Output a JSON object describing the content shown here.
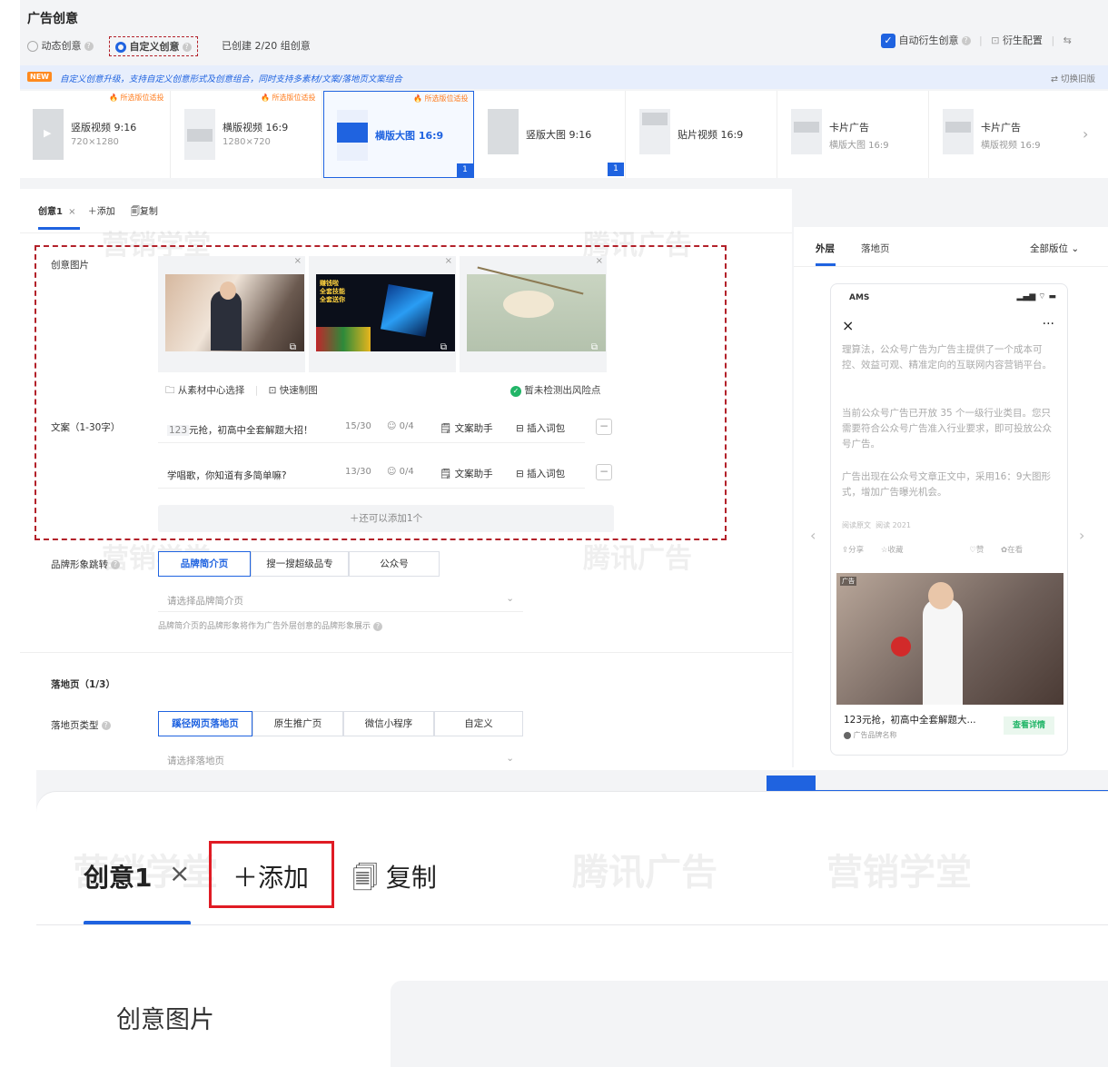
{
  "page": {
    "title": "广告创意"
  },
  "mode": {
    "dynamic_label": "动态创意",
    "custom_label": "自定义创意",
    "created_text": "已创建 2/20 组创意",
    "auto_derive_label": "自动衍生创意",
    "derive_config_label": "衍生配置"
  },
  "banner": {
    "new_tag": "NEW",
    "text": "自定义创意升级，支持自定义创意形式及创意组合，同时支持多素材/文案/落地页文案组合",
    "switch_label": "切换旧版"
  },
  "templates": {
    "hot_label": "所选版位适投",
    "items": [
      {
        "name": "竖版视频 9:16",
        "sub": "720×1280",
        "hot": true
      },
      {
        "name": "横版视频 16:9",
        "sub": "1280×720",
        "hot": true
      },
      {
        "name": "横版大图 16:9",
        "sub": "",
        "hot": true,
        "selected": true,
        "count": "1"
      },
      {
        "name": "竖版大图 9:16",
        "sub": "",
        "count": "1"
      },
      {
        "name": "贴片视频 16:9",
        "sub": ""
      },
      {
        "name": "卡片广告",
        "sub": "横版大图 16:9"
      },
      {
        "name": "卡片广告",
        "sub": "横版视频 16:9"
      }
    ]
  },
  "creative_tabs": {
    "current": "创意1",
    "add_label": "添加",
    "copy_label": "复制"
  },
  "form": {
    "image_label": "创意图片",
    "image_overlay_text": "赚钱啦\n全套技能\n全套送你",
    "material_center": "从素材中心选择",
    "quick_make": "快速制图",
    "risk_text": "暂未检测出风险点",
    "copy_label": "文案（1-30字）",
    "copies": [
      {
        "prefix": "123",
        "text": "元抢，初高中全套解题大招！",
        "count": "15/30",
        "emoji": "0/4",
        "assistant": "文案助手",
        "insert": "插入词包"
      },
      {
        "prefix": "",
        "text": "学唱歌，你知道有多简单嘛?",
        "count": "13/30",
        "emoji": "0/4",
        "assistant": "文案助手",
        "insert": "插入词包"
      }
    ],
    "add_more": "还可以添加1个",
    "brand_label": "品牌形象跳转",
    "brand_options": [
      "品牌简介页",
      "搜一搜超级品专",
      "公众号"
    ],
    "brand_placeholder": "请选择品牌简介页",
    "brand_hint": "品牌简介页的品牌形象将作为广告外层创意的品牌形象展示",
    "landing_title": "落地页（1/3）",
    "landing_type_label": "落地页类型",
    "landing_options": [
      "蹊径网页落地页",
      "原生推广页",
      "微信小程序",
      "自定义"
    ],
    "landing_placeholder": "请选择落地页"
  },
  "preview": {
    "tab_outer": "外层",
    "tab_landing": "落地页",
    "position_select": "全部版位",
    "phone_carrier": "AMS",
    "para1": "理算法，公众号广告为广告主提供了一个成本可控、效益可观、精准定向的互联网内容营销平台。",
    "para2": "当前公众号广告已开放 35 个一级行业类目。您只需要符合公众号广告准入行业要求，即可投放公众号广告。",
    "para3": "广告出现在公众号文章正文中，采用16：9大图形式，增加广告曝光机会。",
    "read_more": "阅读原文",
    "read_count": "阅读 2021",
    "share": "分享",
    "collect": "收藏",
    "like": "赞",
    "watching": "在看",
    "ad_tag": "广告",
    "ad_title": "123元抢，初高中全套解题大...",
    "ad_brand": "广告品牌名称",
    "ad_cta": "查看详情"
  },
  "watermarks": {
    "a": "营销学堂",
    "b": "腾讯广告"
  },
  "zoom": {
    "tab_label": "创意1",
    "add_label": "添加",
    "copy_label": "复制",
    "image_label": "创意图片"
  }
}
